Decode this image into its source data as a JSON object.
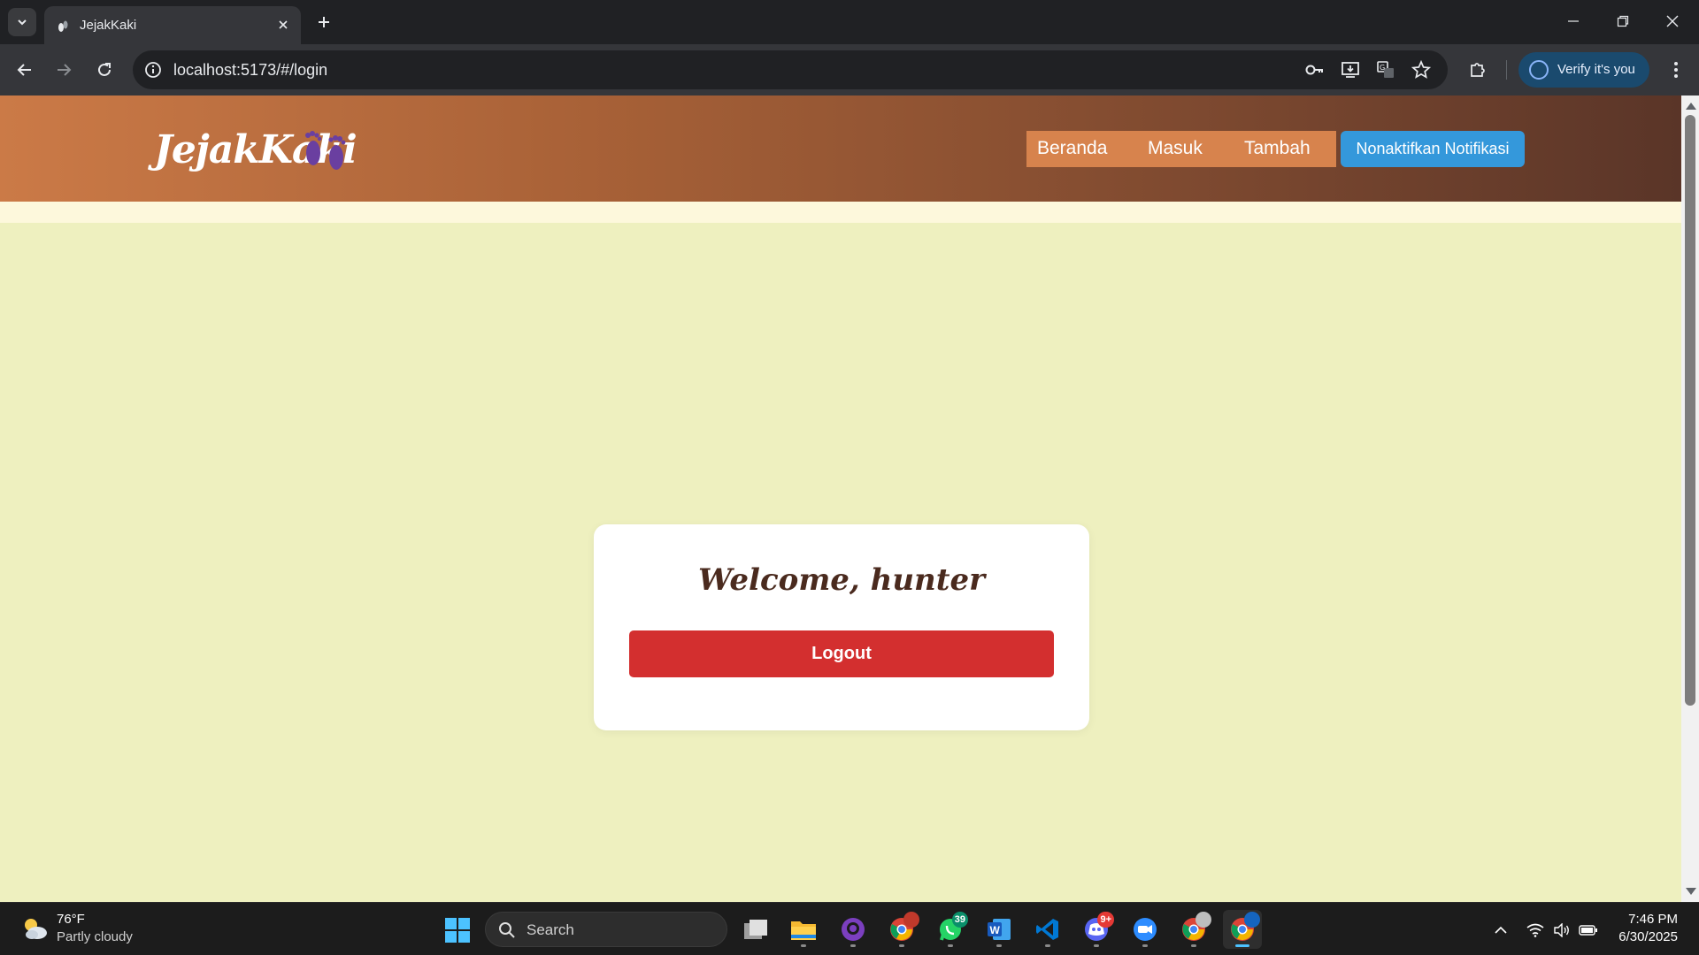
{
  "browser": {
    "tab_title": "JejakKaki",
    "url": "localhost:5173/#/login",
    "verify_label": "Verify it's you"
  },
  "site": {
    "logo_text": "JejakKaki",
    "nav": {
      "home": "Beranda",
      "login": "Masuk",
      "add": "Tambah",
      "notification_button": "Nonaktifkan Notifikasi"
    },
    "card": {
      "welcome": "Welcome, hunter",
      "logout": "Logout"
    }
  },
  "taskbar": {
    "weather_temp": "76°F",
    "weather_desc": "Partly cloudy",
    "search_placeholder": "Search",
    "whatsapp_badge": "39",
    "discord_badge": "9+",
    "time": "7:46 PM",
    "date": "6/30/2025"
  },
  "colors": {
    "header_start": "#cb7a47",
    "header_end": "#5a3528",
    "page_background": "#eef0bf",
    "notification_button": "#3498db",
    "logout_button": "#d32f2f"
  }
}
